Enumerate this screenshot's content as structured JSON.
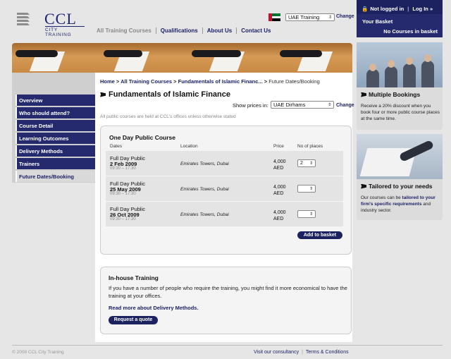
{
  "logo": {
    "brand": "CCL",
    "tagline": "CITY TRAINING"
  },
  "nav": [
    "All Training Courses",
    "Qualifications",
    "About Us",
    "Contact Us"
  ],
  "country": {
    "selected": "UAE Training",
    "change": "Change"
  },
  "basket": {
    "login_status": "Not logged in",
    "login_link": "Log In »",
    "title": "Your Basket",
    "status": "No Courses in basket"
  },
  "menu": [
    "Overview",
    "Who should attend?",
    "Course Detail",
    "Learning Outcomes",
    "Delivery Methods",
    "Trainers",
    "Future Dates/Booking"
  ],
  "breadcrumb": {
    "home": "Home",
    "courses": "All Training Courses",
    "course": "Fundamentals of Islamic Financ...",
    "current": "Future Dates/Booking"
  },
  "page_title": "Fundamentals of Islamic Finance",
  "prices": {
    "label": "Show prices in:",
    "selected": "UAE Dirhams",
    "change": "Change"
  },
  "note": "All public courses are held at CCL's offices unless otherwise stated",
  "course": {
    "title": "One Day Public Course",
    "headers": {
      "dates": "Dates",
      "location": "Location",
      "price": "Price",
      "places": "No of places"
    },
    "rows": [
      {
        "type": "Full Day Public",
        "date": "2 Feb 2009",
        "time": "09:30 – 17:30",
        "location": "Emirates Towers, Dubai",
        "price": "4,000",
        "currency": "AED",
        "qty": "2"
      },
      {
        "type": "Full Day Public",
        "date": "25 May 2009",
        "time": "09:30 – 17:30",
        "location": "Emirates Towers, Dubai",
        "price": "4,000",
        "currency": "AED",
        "qty": ""
      },
      {
        "type": "Full Day Public",
        "date": "26 Oct 2009",
        "time": "09:30 – 17:30",
        "location": "Emirates Towers, Dubai",
        "price": "4,000",
        "currency": "AED",
        "qty": ""
      }
    ],
    "add_button": "Add to basket"
  },
  "inhouse": {
    "title": "In-house Training",
    "text": "If you have a number of people who require the training, you might find it more economical to have the training at your offices.",
    "link": "Read more about Delivery Methods.",
    "button": "Request a quote"
  },
  "promos": {
    "multiple": {
      "title": "Multiple Bookings",
      "text": "Receive a 20% discount when you book four or more public course places at the same time."
    },
    "tailored": {
      "title": "Tailored to your needs",
      "text_pre": "Our courses can be ",
      "text_link": "tailored to your firm's specific requirements",
      "text_post": " and industry sector."
    }
  },
  "footer": {
    "copyright": "© 2008 CCL City Training",
    "links": [
      "Visit our consultancy",
      "Terms & Conditions"
    ]
  },
  "colors": {
    "navy": "#252a6e",
    "page_bg": "#e6e6e6"
  }
}
